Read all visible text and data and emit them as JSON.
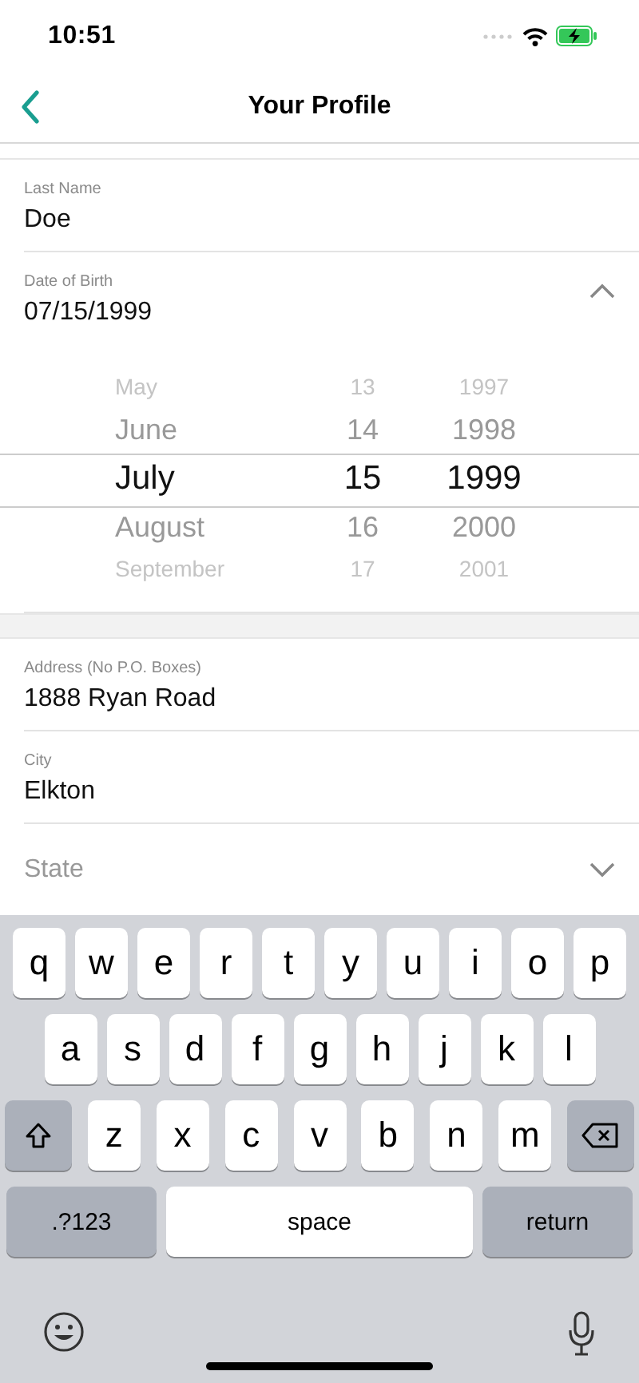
{
  "status_bar": {
    "time": "10:51"
  },
  "nav": {
    "title": "Your Profile"
  },
  "fields": [
    {
      "kind": "text",
      "label": "Last Name",
      "value": "Doe"
    },
    {
      "kind": "date",
      "label": "Date of Birth",
      "value": "07/15/1999",
      "expanded": true,
      "picker": [
        [
          {
            "text": "May",
            "selected": false
          },
          {
            "text": "June",
            "selected": false
          },
          {
            "text": "July",
            "selected": true
          },
          {
            "text": "August",
            "selected": false
          },
          {
            "text": "September",
            "selected": false
          }
        ],
        [
          {
            "text": "13",
            "selected": false
          },
          {
            "text": "14",
            "selected": false
          },
          {
            "text": "15",
            "selected": true
          },
          {
            "text": "16",
            "selected": false
          },
          {
            "text": "17",
            "selected": false
          }
        ],
        [
          {
            "text": "1997",
            "selected": false
          },
          {
            "text": "1998",
            "selected": false
          },
          {
            "text": "1999",
            "selected": true
          },
          {
            "text": "2000",
            "selected": false
          },
          {
            "text": "2001",
            "selected": false
          }
        ]
      ]
    },
    {
      "kind": "gap"
    },
    {
      "kind": "text",
      "label": "Address (No P.O. Boxes)",
      "value": "1888 Ryan Road"
    },
    {
      "kind": "text",
      "label": "City",
      "value": "Elkton"
    },
    {
      "kind": "select",
      "placeholder": "State",
      "expanded": false
    }
  ],
  "keyboard": {
    "letter_rows": [
      [
        {
          "kind": "letter",
          "text": "q"
        },
        {
          "kind": "letter",
          "text": "w"
        },
        {
          "kind": "letter",
          "text": "e"
        },
        {
          "kind": "letter",
          "text": "r"
        },
        {
          "kind": "letter",
          "text": "t"
        },
        {
          "kind": "letter",
          "text": "y"
        },
        {
          "kind": "letter",
          "text": "u"
        },
        {
          "kind": "letter",
          "text": "i"
        },
        {
          "kind": "letter",
          "text": "o"
        },
        {
          "kind": "letter",
          "text": "p"
        }
      ],
      [
        {
          "kind": "letter",
          "text": "a"
        },
        {
          "kind": "letter",
          "text": "s"
        },
        {
          "kind": "letter",
          "text": "d"
        },
        {
          "kind": "letter",
          "text": "f"
        },
        {
          "kind": "letter",
          "text": "g"
        },
        {
          "kind": "letter",
          "text": "h"
        },
        {
          "kind": "letter",
          "text": "j"
        },
        {
          "kind": "letter",
          "text": "k"
        },
        {
          "kind": "letter",
          "text": "l"
        }
      ],
      [
        {
          "kind": "shift"
        },
        {
          "kind": "letter",
          "text": "z"
        },
        {
          "kind": "letter",
          "text": "x"
        },
        {
          "kind": "letter",
          "text": "c"
        },
        {
          "kind": "letter",
          "text": "v"
        },
        {
          "kind": "letter",
          "text": "b"
        },
        {
          "kind": "letter",
          "text": "n"
        },
        {
          "kind": "letter",
          "text": "m"
        },
        {
          "kind": "delete"
        }
      ]
    ],
    "bottom_keys": [
      {
        "kind": "mode",
        "text": ".?123"
      },
      {
        "kind": "space",
        "text": "space"
      },
      {
        "kind": "return",
        "text": "return"
      }
    ],
    "accessory_keys": [
      {
        "kind": "emoji"
      },
      {
        "kind": "dictation"
      }
    ]
  }
}
